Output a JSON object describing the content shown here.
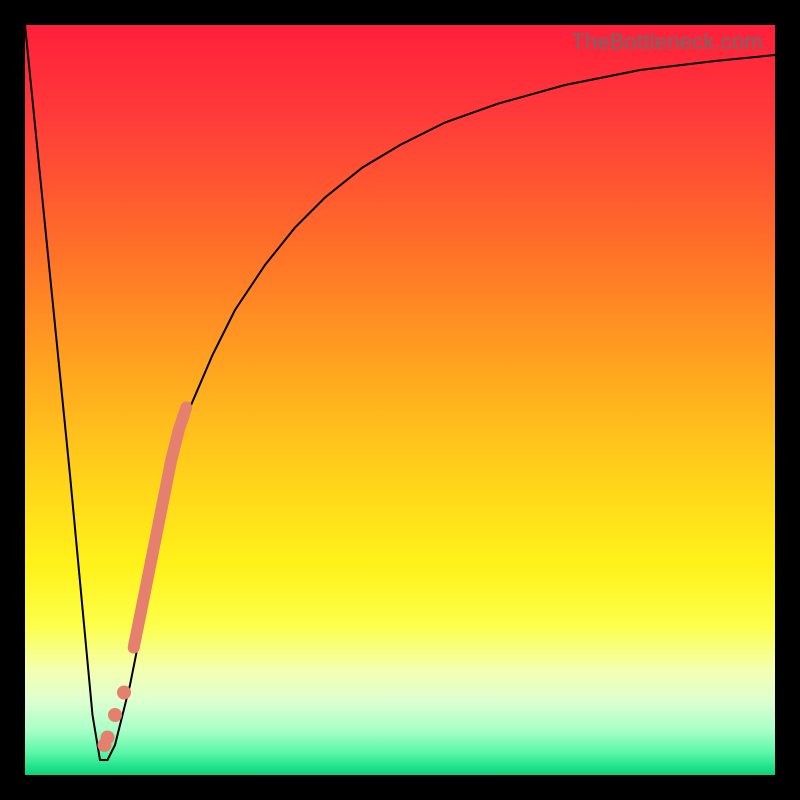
{
  "watermark": "TheBottleneck.com",
  "chart_data": {
    "type": "line",
    "title": "",
    "xlabel": "",
    "ylabel": "",
    "xlim": [
      0,
      100
    ],
    "ylim": [
      0,
      100
    ],
    "grid": false,
    "series": [
      {
        "name": "bottleneck-curve",
        "color": "#000000",
        "stroke_width": 2,
        "x": [
          0,
          3,
          6,
          9,
          10,
          11,
          12,
          14,
          16,
          18,
          20,
          22,
          25,
          28,
          32,
          36,
          40,
          45,
          50,
          56,
          63,
          72,
          82,
          92,
          100
        ],
        "y": [
          100,
          70,
          40,
          8,
          2,
          2,
          4,
          12,
          22,
          32,
          42,
          49,
          56,
          62,
          68,
          73,
          77,
          81,
          84,
          87,
          89.5,
          92,
          94,
          95.2,
          96
        ]
      },
      {
        "name": "highlight-band",
        "color": "#e6806e",
        "stroke_width": 12,
        "x": [
          14.5,
          15.5,
          16.5,
          17.5,
          18.5,
          19.5,
          20.5,
          21.5
        ],
        "y": [
          17,
          22,
          27,
          32,
          37,
          42,
          46,
          49
        ]
      },
      {
        "name": "highlight-dots",
        "color": "#e6806e",
        "type_override": "scatter",
        "radius": 7,
        "x": [
          13.2,
          12.0,
          11.0,
          10.6
        ],
        "y": [
          11,
          8,
          5,
          4
        ]
      }
    ]
  }
}
